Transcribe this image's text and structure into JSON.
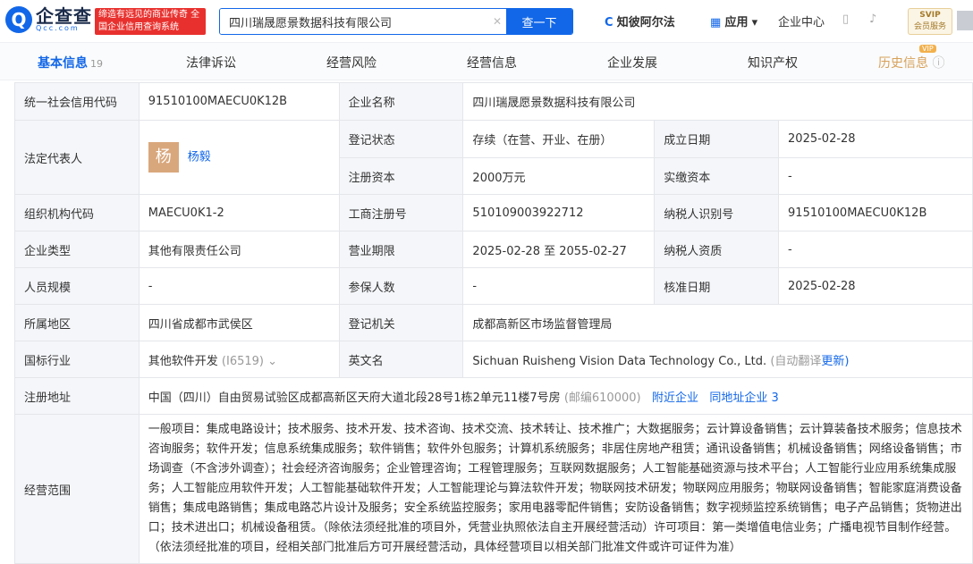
{
  "brand": {
    "logo_glyph": "Q",
    "name": "企查查",
    "domain": "Qcc.com",
    "slogan": "缔造有远见的商业传奇 全国企业信用查询系统",
    "accent": "#1267e8"
  },
  "search": {
    "value": "四川瑞晟愿景数据科技有限公司",
    "button": "查一下"
  },
  "nav": {
    "ai": "知彼阿尔法",
    "apps": "应用",
    "center": "企业中心",
    "vip_top": "SVIP",
    "vip_bottom": "会员服务"
  },
  "tabs": [
    {
      "label": "基本信息",
      "count": "19"
    },
    {
      "label": "法律诉讼"
    },
    {
      "label": "经营风险"
    },
    {
      "label": "经营信息"
    },
    {
      "label": "企业发展"
    },
    {
      "label": "知识产权"
    },
    {
      "label": "历史信息",
      "badge": "VIP"
    }
  ],
  "info": {
    "credit_code_label": "统一社会信用代码",
    "credit_code": "91510100MAECU0K12B",
    "name_label": "企业名称",
    "name": "四川瑞晟愿景数据科技有限公司",
    "legal_label": "法定代表人",
    "legal_avatar": "杨",
    "legal": "杨毅",
    "status_label": "登记状态",
    "status": "存续（在营、开业、在册）",
    "est_label": "成立日期",
    "est": "2025-02-28",
    "capital_label": "注册资本",
    "capital": "2000万元",
    "paid_label": "实缴资本",
    "paid": "-",
    "org_label": "组织机构代码",
    "org": "MAECU0K1-2",
    "reg_label": "工商注册号",
    "reg": "510109003922712",
    "tax_label": "纳税人识别号",
    "tax": "91510100MAECU0K12B",
    "type_label": "企业类型",
    "type": "其他有限责任公司",
    "term_label": "营业期限",
    "term": "2025-02-28 至 2055-02-27",
    "taxq_label": "纳税人资质",
    "taxq": "-",
    "staff_label": "人员规模",
    "staff": "-",
    "insured_label": "参保人数",
    "insured": "-",
    "approve_label": "核准日期",
    "approve": "2025-02-28",
    "region_label": "所属地区",
    "region": "四川省成都市武侯区",
    "authority_label": "登记机关",
    "authority": "成都高新区市场监督管理局",
    "industry_label": "国标行业",
    "industry": "其他软件开发",
    "industry_code": "(I6519)",
    "en_label": "英文名",
    "en": "Sichuan Ruisheng Vision Data Technology Co., Ltd.",
    "en_note": "(自动翻译",
    "en_update": "更新)",
    "addr_label": "注册地址",
    "addr": "中国（四川）自由贸易试验区成都高新区天府大道北段28号1栋2单元11楼7号房",
    "postcode": "(邮编610000)",
    "nearby": "附近企业",
    "same_addr": "同地址企业 3",
    "scope_label": "经营范围",
    "scope": "一般项目：集成电路设计；技术服务、技术开发、技术咨询、技术交流、技术转让、技术推广；大数据服务；云计算设备销售；云计算装备技术服务；信息技术咨询服务；软件开发；信息系统集成服务；软件销售；软件外包服务；计算机系统服务；非居住房地产租赁；通讯设备销售；机械设备销售；网络设备销售；市场调查（不含涉外调查）；社会经济咨询服务；企业管理咨询；工程管理服务；互联网数据服务；人工智能基础资源与技术平台；人工智能行业应用系统集成服务；人工智能应用软件开发；人工智能基础软件开发；人工智能理论与算法软件开发；物联网技术研发；物联网应用服务；物联网设备销售；智能家庭消费设备销售；集成电路销售；集成电路芯片设计及服务；安全系统监控服务；家用电器零配件销售；安防设备销售；数字视频监控系统销售；电子产品销售；货物进出口；技术进出口；机械设备租赁。（除依法须经批准的项目外，凭营业执照依法自主开展经营活动）许可项目：第一类增值电信业务；广播电视节目制作经营。（依法须经批准的项目，经相关部门批准后方可开展经营活动，具体经营项目以相关部门批准文件或许可证件为准）"
  }
}
